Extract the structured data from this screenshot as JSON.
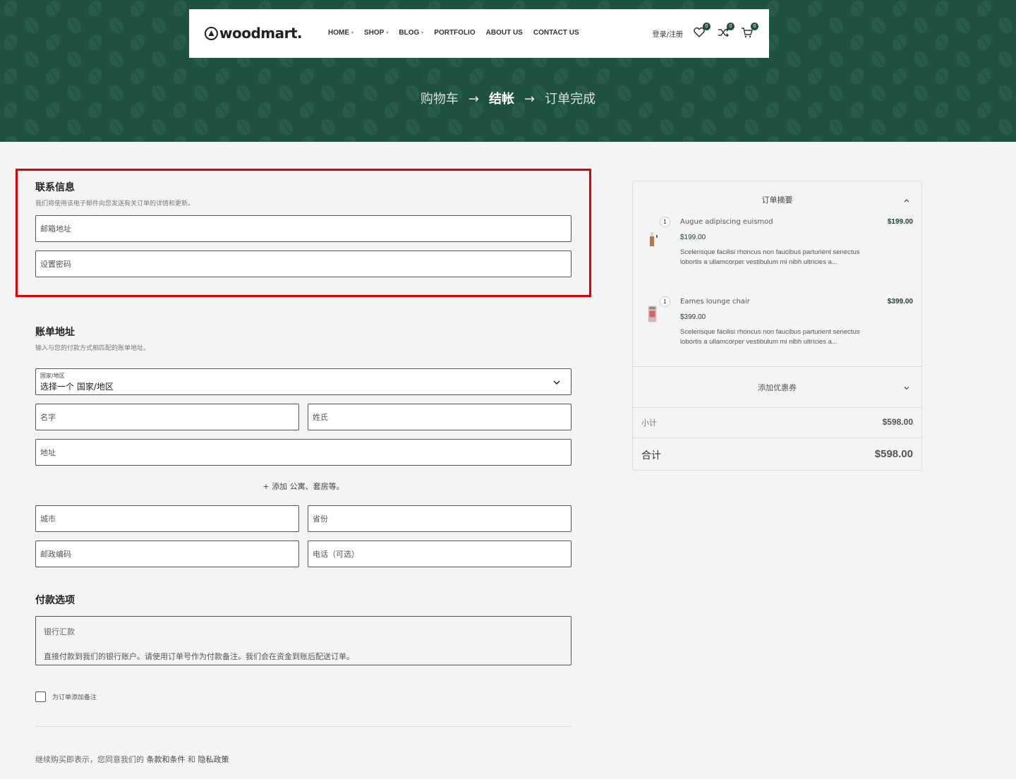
{
  "header": {
    "logo_text": "woodmart.",
    "nav": [
      {
        "label": "HOME",
        "has_dropdown": true
      },
      {
        "label": "SHOP",
        "has_dropdown": true
      },
      {
        "label": "BLOG",
        "has_dropdown": true
      },
      {
        "label": "PORTFOLIO",
        "has_dropdown": false
      },
      {
        "label": "ABOUT US",
        "has_dropdown": false
      },
      {
        "label": "CONTACT US",
        "has_dropdown": false
      }
    ],
    "login_label": "登录/注册",
    "wishlist_count": "0",
    "compare_count": "0",
    "cart_count": "0"
  },
  "steps": {
    "cart": "购物车",
    "checkout": "结帐",
    "complete": "订单完成",
    "arrow": "→"
  },
  "contact": {
    "title": "联系信息",
    "subtitle": "我们将使用该电子邮件向您发送有关订单的详情和更新。",
    "email_placeholder": "邮箱地址",
    "password_placeholder": "设置密码"
  },
  "billing": {
    "title": "账单地址",
    "subtitle": "输入与您的付款方式相匹配的账单地址。",
    "country_label": "国家/地区",
    "country_value": "选择一个 国家/地区",
    "first_name": "名字",
    "last_name": "姓氏",
    "address": "地址",
    "add_apartment": "+ 添加 公寓、套房等。",
    "city": "城市",
    "province": "省份",
    "postcode": "邮政编码",
    "phone": "电话（可选）"
  },
  "payment": {
    "title": "付款选项",
    "method": "银行汇款",
    "description": "直接付款到我们的银行账户。请使用订单号作为付款备注。我们会在资金到账后配送订单。"
  },
  "order_note_label": "为订单添加备注",
  "terms": {
    "prefix": "继续购买即表示，您同意我们的",
    "terms_link": "条款和条件",
    "and": "和",
    "privacy_link": "隐私政策"
  },
  "summary": {
    "title": "订单摘要",
    "products": [
      {
        "qty": "1",
        "name": "Augue adipiscing euismod",
        "price": "$199.00",
        "unit_price": "$199.00",
        "desc": "Scelerisque facilisi rhoncus non faucibus parturient senectus lobortis a ullamcorper vestibulum mi nibh ultricies a..."
      },
      {
        "qty": "1",
        "name": "Eames lounge chair",
        "price": "$399.00",
        "unit_price": "$399.00",
        "desc": "Scelerisque facilisi rhoncus non faucibus parturient senectus lobortis a ullamcorper vestibulum mi nibh ultricies a..."
      }
    ],
    "coupon_label": "添加优惠券",
    "subtotal_label": "小计",
    "subtotal_value": "$598.00",
    "total_label": "合计",
    "total_value": "$598.00"
  },
  "colors": {
    "brand_green": "#1f5140",
    "highlight_red": "#e00000"
  }
}
